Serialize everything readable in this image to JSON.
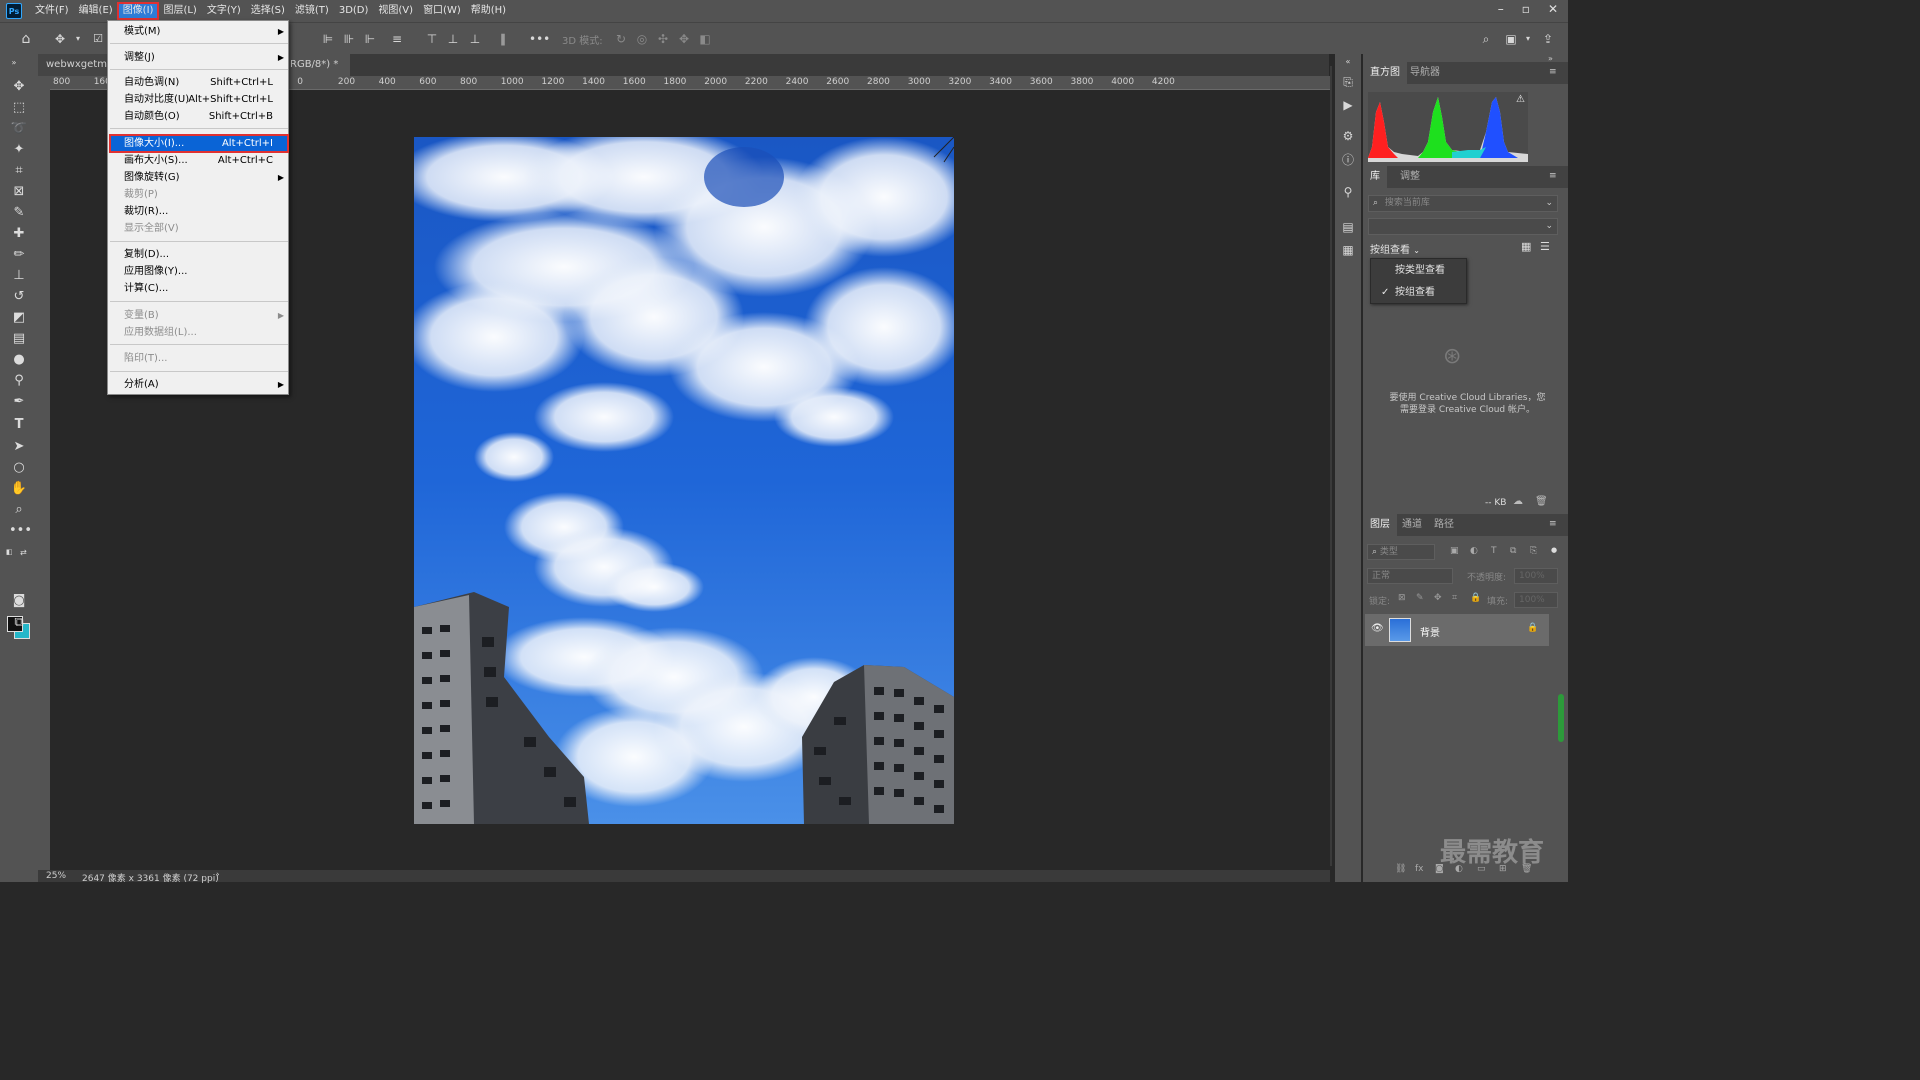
{
  "menubar": {
    "logo": "Ps",
    "items": [
      "文件(F)",
      "编辑(E)",
      "图像(I)",
      "图层(L)",
      "文字(Y)",
      "选择(S)",
      "滤镜(T)",
      "3D(D)",
      "视图(V)",
      "窗口(W)",
      "帮助(H)"
    ],
    "active_index": 2
  },
  "optionsbar": {
    "mode3d_label": "3D 模式:"
  },
  "tabs": {
    "doc1": "webwxgetmsg",
    "doc2_suffix": "RGB/8*) *",
    "close": "×"
  },
  "ruler_h_ticks": [
    "800",
    "1600",
    "",
    "600",
    "400",
    "200",
    "0",
    "200",
    "400",
    "600",
    "800",
    "1000",
    "1200",
    "1400",
    "1600",
    "1800",
    "2000",
    "2200",
    "2400",
    "2600",
    "2800",
    "3000",
    "3200",
    "3400",
    "3600",
    "3800",
    "4000",
    "4200"
  ],
  "image_menu": {
    "items": [
      {
        "label": "模式(M)",
        "shortcut": "",
        "submenu": true,
        "disabled": false
      },
      {
        "label": "调整(J)",
        "shortcut": "",
        "submenu": true,
        "disabled": false
      },
      {
        "label": "自动色调(N)",
        "shortcut": "Shift+Ctrl+L",
        "submenu": false,
        "disabled": false
      },
      {
        "label": "自动对比度(U)",
        "shortcut": "Alt+Shift+Ctrl+L",
        "submenu": false,
        "disabled": false
      },
      {
        "label": "自动颜色(O)",
        "shortcut": "Shift+Ctrl+B",
        "submenu": false,
        "disabled": false
      },
      {
        "label": "图像大小(I)...",
        "shortcut": "Alt+Ctrl+I",
        "submenu": false,
        "disabled": false
      },
      {
        "label": "画布大小(S)...",
        "shortcut": "Alt+Ctrl+C",
        "submenu": false,
        "disabled": false
      },
      {
        "label": "图像旋转(G)",
        "shortcut": "",
        "submenu": true,
        "disabled": false
      },
      {
        "label": "裁剪(P)",
        "shortcut": "",
        "submenu": false,
        "disabled": true
      },
      {
        "label": "裁切(R)...",
        "shortcut": "",
        "submenu": false,
        "disabled": false
      },
      {
        "label": "显示全部(V)",
        "shortcut": "",
        "submenu": false,
        "disabled": true
      },
      {
        "label": "复制(D)...",
        "shortcut": "",
        "submenu": false,
        "disabled": false
      },
      {
        "label": "应用图像(Y)...",
        "shortcut": "",
        "submenu": false,
        "disabled": false
      },
      {
        "label": "计算(C)...",
        "shortcut": "",
        "submenu": false,
        "disabled": false
      },
      {
        "label": "变量(B)",
        "shortcut": "",
        "submenu": true,
        "disabled": true
      },
      {
        "label": "应用数据组(L)...",
        "shortcut": "",
        "submenu": false,
        "disabled": true
      },
      {
        "label": "陷印(T)...",
        "shortcut": "",
        "submenu": false,
        "disabled": true
      },
      {
        "label": "分析(A)",
        "shortcut": "",
        "submenu": true,
        "disabled": false
      }
    ],
    "highlighted_index": 5
  },
  "panels": {
    "histogram_tabs": [
      "直方图",
      "导航器"
    ],
    "library_tabs": [
      "库",
      "调整"
    ],
    "search_placeholder": "搜索当前库",
    "group_view_label": "按组查看",
    "dropdown_items": [
      "按类型查看",
      "按组查看"
    ],
    "dropdown_checked_index": 1,
    "cc_message_line1": "要使用 Creative Cloud Libraries，您",
    "cc_message_line2": "需要登录 Creative Cloud 帐户。",
    "kb_label": "-- KB",
    "layers_tabs": [
      "图层",
      "通道",
      "路径"
    ],
    "filter_label": "类型",
    "blend_mode": "正常",
    "opacity_label": "不透明度:",
    "opacity_value": "100%",
    "lock_label": "锁定:",
    "fill_label": "填充:",
    "fill_value": "100%",
    "layer_name": "背景"
  },
  "status": {
    "zoom": "25%",
    "doc_info": "2647 像素 x 3361 像素 (72 ppi)",
    "arrow": "›"
  },
  "watermark": "最需教育"
}
